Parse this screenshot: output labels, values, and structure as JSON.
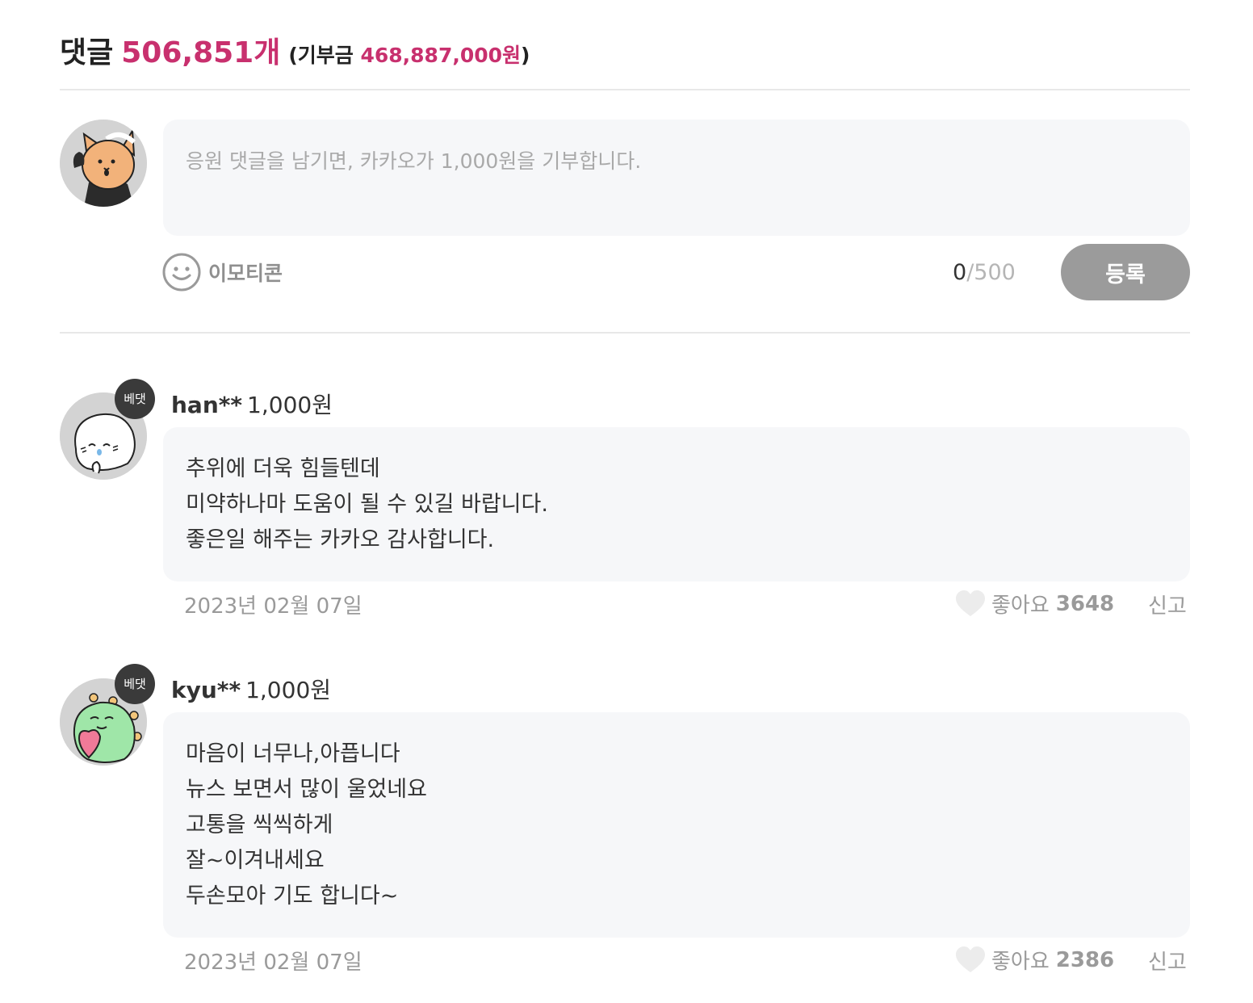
{
  "header": {
    "comments_label": "댓글",
    "comments_count": "506,851개",
    "donation_open": "(기부금 ",
    "donation_amount": "468,887,000원",
    "donation_close": ")"
  },
  "composer": {
    "placeholder": "응원 댓글을 남기면, 카카오가 1,000원을 기부합니다.",
    "emoticon_label": "이모티콘",
    "char_count": "0",
    "char_separator": "/",
    "char_max": "500",
    "submit_label": "등록"
  },
  "comments": [
    {
      "badge": "베댓",
      "user": "han**",
      "amount": "1,000원",
      "lines": [
        "추위에 더욱 힘들텐데",
        "미약하나마 도움이 될 수 있길 바랍니다.",
        "좋은일 해주는 카카오 감사합니다."
      ],
      "date": "2023년 02월 07일",
      "like_label": "좋아요",
      "like_count": "3648",
      "report_label": "신고"
    },
    {
      "badge": "베댓",
      "user": "kyu**",
      "amount": "1,000원",
      "lines": [
        "마음이 너무나,아픕니다",
        "뉴스 보면서 많이 울었네요",
        "고통을 씩씩하게",
        "잘~이겨내세요",
        "두손모아 기도 합니다~"
      ],
      "date": "2023년 02월 07일",
      "like_label": "좋아요",
      "like_count": "2386",
      "report_label": "신고"
    }
  ],
  "colors": {
    "accent": "#c8306e",
    "submit_bg": "#9b9b9b",
    "bubble_bg": "#f6f7f9",
    "badge_bg": "#3a3a3a"
  },
  "icons": {
    "my_avatar": "orange-cat-waving-icon",
    "emoticon": "smiley-face-icon",
    "like": "heart-icon",
    "comment_1_avatar": "white-blob-crying-icon",
    "comment_2_avatar": "green-dino-heart-icon"
  }
}
